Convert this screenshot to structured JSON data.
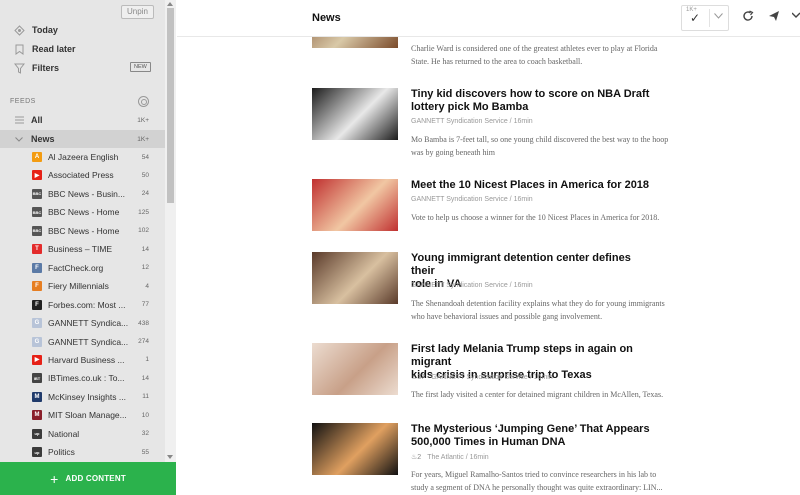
{
  "sidebar": {
    "unpin_label": "Unpin",
    "nav": [
      {
        "label": "Today",
        "icon": "today-icon"
      },
      {
        "label": "Read later",
        "icon": "bookmark-icon"
      },
      {
        "label": "Filters",
        "icon": "filter-icon",
        "badge": "NEW"
      }
    ],
    "feeds_label": "FEEDS",
    "groups": [
      {
        "label": "All",
        "count": "1K+"
      },
      {
        "label": "News",
        "count": "1K+"
      }
    ],
    "feeds": [
      {
        "name": "Al Jazeera English",
        "count": "54",
        "icon_color": "#f39c12",
        "icon_char": "A"
      },
      {
        "name": "Associated Press",
        "count": "50",
        "icon_color": "#e62117",
        "icon_char": "▶"
      },
      {
        "name": "BBC News - Busin...",
        "count": "24",
        "icon_color": "#555555",
        "icon_char": "BBC"
      },
      {
        "name": "BBC News - Home",
        "count": "125",
        "icon_color": "#555555",
        "icon_char": "BBC"
      },
      {
        "name": "BBC News - Home",
        "count": "102",
        "icon_color": "#555555",
        "icon_char": "BBC"
      },
      {
        "name": "Business – TIME",
        "count": "14",
        "icon_color": "#e32b2b",
        "icon_char": "T"
      },
      {
        "name": "FactCheck.org",
        "count": "12",
        "icon_color": "#5b7aa6",
        "icon_char": "F"
      },
      {
        "name": "Fiery Millennials",
        "count": "4",
        "icon_color": "#e67e22",
        "icon_char": "F"
      },
      {
        "name": "Forbes.com: Most ...",
        "count": "77",
        "icon_color": "#222222",
        "icon_char": "F"
      },
      {
        "name": "GANNETT Syndica...",
        "count": "438",
        "icon_color": "#b8c4d8",
        "icon_char": "G"
      },
      {
        "name": "GANNETT Syndica...",
        "count": "274",
        "icon_color": "#b8c4d8",
        "icon_char": "G"
      },
      {
        "name": "Harvard Business ...",
        "count": "1",
        "icon_color": "#e62117",
        "icon_char": "▶"
      },
      {
        "name": "IBTimes.co.uk : To...",
        "count": "14",
        "icon_color": "#444444",
        "icon_char": "IBT"
      },
      {
        "name": "McKinsey Insights ...",
        "count": "11",
        "icon_color": "#1f3a6b",
        "icon_char": "M"
      },
      {
        "name": "MIT Sloan Manage...",
        "count": "10",
        "icon_color": "#8a1f2a",
        "icon_char": "M"
      },
      {
        "name": "National",
        "count": "32",
        "icon_color": "#3a3a3a",
        "icon_char": "up"
      },
      {
        "name": "Politics",
        "count": "55",
        "icon_color": "#3a3a3a",
        "icon_char": "up"
      }
    ],
    "add_content_label": "ADD CONTENT"
  },
  "header": {
    "title": "News",
    "markread_badge": "1K+"
  },
  "articles": [
    {
      "title": "",
      "meta": "",
      "engagement": "",
      "snippet_lines": [
        "Charlie Ward is considered one of the greatest athletes ever to play at Florida",
        "State. He has returned to the area to coach basketball."
      ],
      "thumb_colors": [
        "#7a4a2a",
        "#d9c9a8"
      ]
    },
    {
      "title_lines": [
        "Tiny kid discovers how to score on NBA Draft",
        "lottery pick Mo Bamba"
      ],
      "meta": "GANNETT Syndication Service / 16min",
      "engagement": "",
      "snippet_lines": [
        "Mo Bamba is 7-feet tall, so one young child discovered the best way to the hoop",
        "was by going beneath him"
      ],
      "thumb_colors": [
        "#1b1b1b",
        "#e8e8e8"
      ]
    },
    {
      "title_lines": [
        "Meet the 10 Nicest Places in America for 2018"
      ],
      "meta": "GANNETT Syndication Service / 16min",
      "engagement": "",
      "snippet_lines": [
        "Vote to help us choose a winner for the 10 Nicest Places in America for 2018."
      ],
      "thumb_colors": [
        "#c03030",
        "#f1c7a3"
      ]
    },
    {
      "title_lines": [
        "Young immigrant detention center defines their",
        "role in VA"
      ],
      "meta": "GANNETT Syndication Service / 16min",
      "engagement": "",
      "snippet_lines": [
        "The Shenandoah detention facility explains what they do for young immigrants",
        "who have behavioral issues and possible gang involvement."
      ],
      "thumb_colors": [
        "#5a3a2a",
        "#d8c0a0"
      ]
    },
    {
      "title_lines": [
        "First lady Melania Trump steps in again on migrant",
        "kids crisis in surprise trip to Texas"
      ],
      "meta": "GANNETT Syndication Service / 16min",
      "engagement": "37",
      "snippet_lines": [
        "The first lady visited a center for detained migrant children in McAllen, Texas."
      ],
      "thumb_colors": [
        "#ecdcd0",
        "#c8a088"
      ]
    },
    {
      "title_lines": [
        "The Mysterious ‘Jumping Gene’ That Appears",
        "500,000 Times in Human DNA"
      ],
      "meta": "The Atlantic / 16min",
      "engagement": "2",
      "snippet_lines": [
        "For years, Miguel Ramalho-Santos tried to convince researchers in his lab to",
        "study a segment of DNA he personally thought was quite extraordinary: LIN..."
      ],
      "thumb_colors": [
        "#111111",
        "#e0a060"
      ]
    }
  ]
}
